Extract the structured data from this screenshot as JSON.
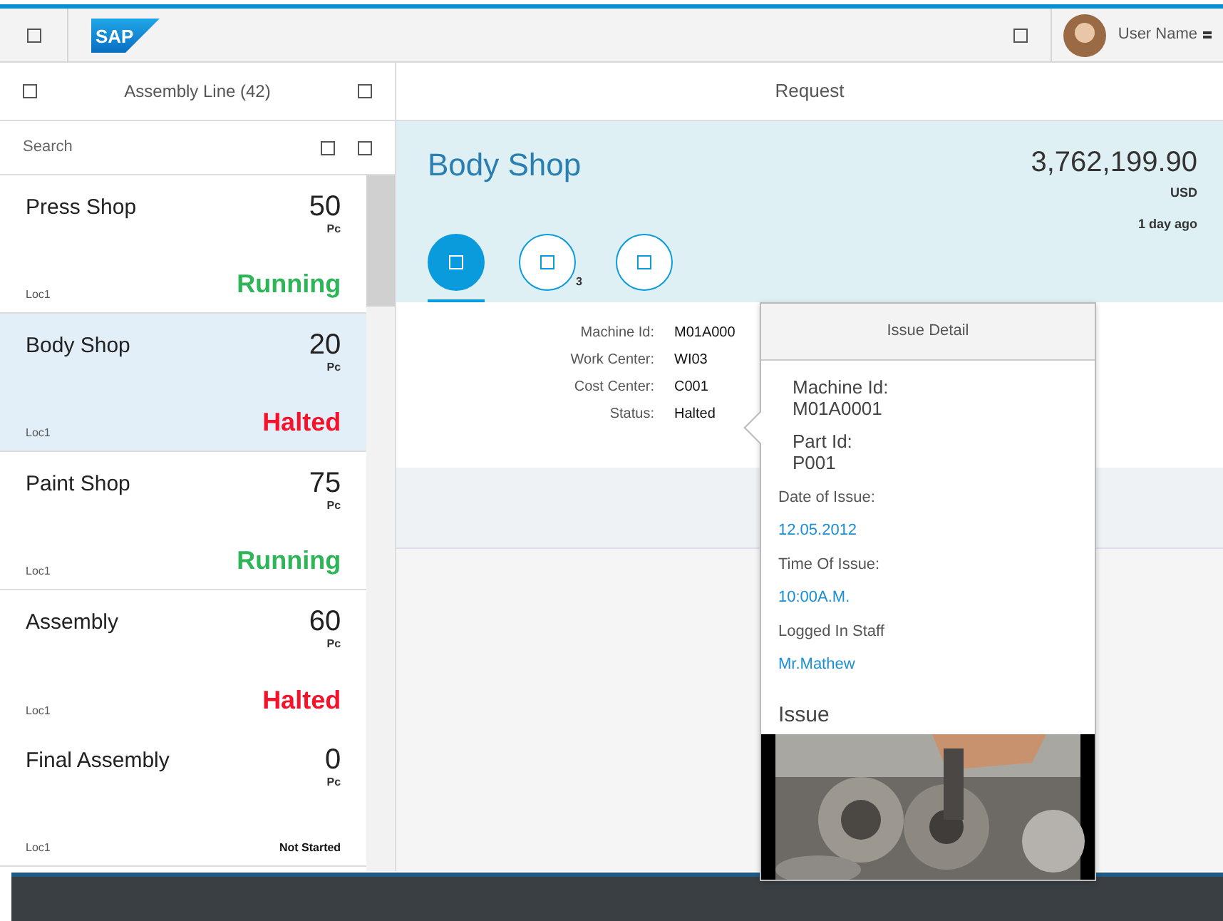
{
  "shell": {
    "logo": "SAP",
    "user_name": "User Name"
  },
  "master": {
    "title": "Assembly Line (42)",
    "search": {
      "placeholder": "Search"
    },
    "items": [
      {
        "title": "Press Shop",
        "number": "50",
        "unit": "Pc",
        "location": "Loc1",
        "status": "Running",
        "kind": "emphasized",
        "color": "#2db558",
        "selected": false
      },
      {
        "title": "Body Shop",
        "number": "20",
        "unit": "Pc",
        "location": "Loc1",
        "status": "Halted",
        "kind": "emphasized",
        "color": "#f5122b",
        "selected": true
      },
      {
        "title": "Paint Shop",
        "number": "75",
        "unit": "Pc",
        "location": "Loc1",
        "status": "Running",
        "kind": "emphasized",
        "color": "#2db558",
        "selected": false
      },
      {
        "title": "Assembly",
        "number": "60",
        "unit": "Pc",
        "location": "Loc1",
        "status": "Halted",
        "kind": "emphasized",
        "color": "#f5122b",
        "selected": false
      },
      {
        "title": "Final Assembly",
        "number": "0",
        "unit": "Pc",
        "location": "Loc1",
        "status": "Not Started",
        "kind": "plain",
        "color": "#111111",
        "selected": false
      }
    ]
  },
  "detail": {
    "header": "Request",
    "object": {
      "title": "Body Shop",
      "number": "3,762,199.90",
      "unit": "USD",
      "time": "1 day ago"
    },
    "tabs": [
      {
        "selected": true
      },
      {
        "count": "3",
        "selected": false
      },
      {
        "selected": false
      }
    ],
    "fields": [
      {
        "label": "Machine Id:",
        "value": "M01A000"
      },
      {
        "label": "Work Center:",
        "value": "WI03"
      },
      {
        "label": "Cost Center:",
        "value": "C001"
      },
      {
        "label": "Status:",
        "value": "Halted"
      }
    ]
  },
  "popover": {
    "title": "Issue Detail",
    "groups": [
      {
        "label": "Machine Id:",
        "value": "M01A0001"
      },
      {
        "label": "Part Id:",
        "value": "P001"
      }
    ],
    "items": [
      {
        "label": "Date of Issue:",
        "value": "12.05.2012"
      },
      {
        "label": "Time Of Issue:",
        "value": "10:00A.M."
      },
      {
        "label": "Logged In Staff",
        "value": "Mr.Mathew"
      }
    ],
    "section": "Issue"
  }
}
